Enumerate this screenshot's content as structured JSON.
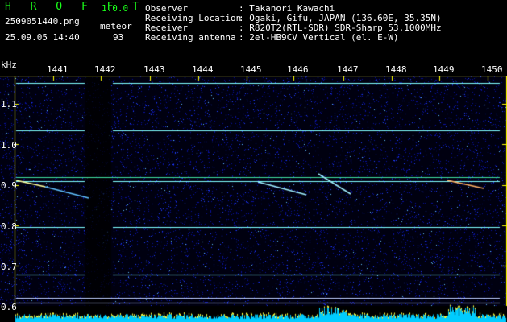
{
  "header": {
    "app_title": "H R O F F T",
    "version": "1.0.0",
    "filename": "2509051440.png",
    "datetime": "25.09.05 14:40",
    "meteor_label": "meteor",
    "meteor_count": "93",
    "fields": [
      {
        "label": "Observer",
        "value": ": Takanori Kawachi"
      },
      {
        "label": "Receiving Location",
        "value": ": Ogaki, Gifu, JAPAN (136.60E, 35.35N)"
      },
      {
        "label": "Receiver",
        "value": ": R820T2(RTL-SDR) SDR-Sharp 53.1000MHz"
      },
      {
        "label": "Receiving antenna",
        "value": ": 2el-HB9CV Vertical (el. E-W)"
      }
    ]
  },
  "axis": {
    "unit": "kHz",
    "x_ticks": [
      "1441",
      "1442",
      "1443",
      "1444",
      "1445",
      "1446",
      "1447",
      "1448",
      "1449",
      "1450"
    ],
    "y_ticks": [
      "1.1",
      "1.0",
      "0.9",
      "0.8",
      "0.7",
      "0.6"
    ]
  },
  "colors": {
    "axis": "#ffff00",
    "label": "#1aff1a",
    "trace": "#80ffff",
    "noise": "#1020ff",
    "bars": "#00ccff"
  }
}
